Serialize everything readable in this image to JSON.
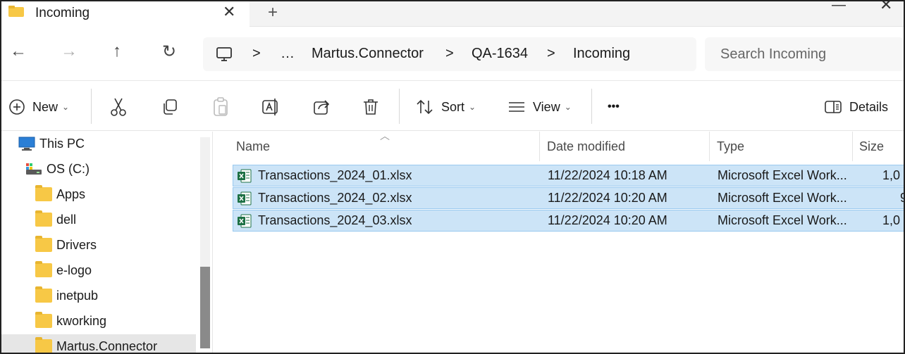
{
  "tab": {
    "title": "Incoming",
    "close": "✕",
    "new_tab": "+"
  },
  "window": {
    "minimize": "—",
    "close": "✕"
  },
  "nav": {
    "back": "←",
    "forward": "→",
    "up": "↑",
    "refresh": "↻"
  },
  "address": {
    "crumbs": [
      "…",
      "Martus.Connector",
      "QA-1634",
      "Incoming"
    ],
    "separator": ">"
  },
  "search": {
    "placeholder": "Search Incoming"
  },
  "toolbar": {
    "new_label": "New",
    "sort_label": "Sort",
    "view_label": "View",
    "more_label": "•••",
    "details_label": "Details"
  },
  "tree": {
    "items": [
      {
        "label": "This PC",
        "icon": "computer-icon"
      },
      {
        "label": "OS (C:)",
        "icon": "drive-icon"
      },
      {
        "label": "Apps",
        "icon": "folder-icon"
      },
      {
        "label": "dell",
        "icon": "folder-icon"
      },
      {
        "label": "Drivers",
        "icon": "folder-icon"
      },
      {
        "label": "e-logo",
        "icon": "folder-icon"
      },
      {
        "label": "inetpub",
        "icon": "folder-icon"
      },
      {
        "label": "kworking",
        "icon": "folder-icon"
      },
      {
        "label": "Martus.Connector",
        "icon": "folder-icon"
      }
    ]
  },
  "columns": {
    "name": "Name",
    "date": "Date modified",
    "type": "Type",
    "size": "Size"
  },
  "files": [
    {
      "name": "Transactions_2024_01.xlsx",
      "date": "11/22/2024 10:18 AM",
      "type": "Microsoft Excel Work...",
      "size": "1,0"
    },
    {
      "name": "Transactions_2024_02.xlsx",
      "date": "11/22/2024 10:20 AM",
      "type": "Microsoft Excel Work...",
      "size": "9"
    },
    {
      "name": "Transactions_2024_03.xlsx",
      "date": "11/22/2024 10:20 AM",
      "type": "Microsoft Excel Work...",
      "size": "1,0"
    }
  ],
  "colors": {
    "selection_bg": "#cce4f7",
    "selection_border": "#99c9ef",
    "folder": "#f7c846",
    "excel_green": "#1d7044"
  }
}
